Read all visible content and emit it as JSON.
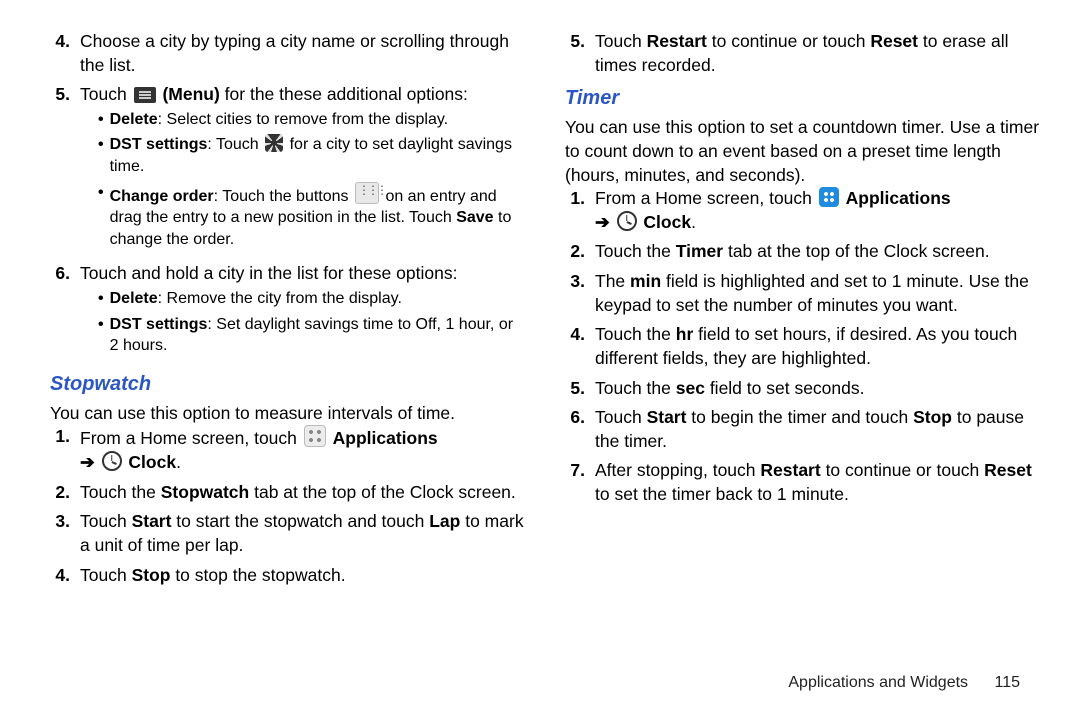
{
  "left": {
    "items": [
      {
        "n": "4.",
        "text": "Choose a city by typing a city name or scrolling through the list."
      },
      {
        "n": "5.",
        "pre": "Touch ",
        "bold1": "(Menu)",
        "post": " for the these additional options:"
      }
    ],
    "bullets5": [
      {
        "bold": "Delete",
        "rest": ": Select cities to remove from the display."
      },
      {
        "bold": "DST settings",
        "pre": ": Touch ",
        "post": " for a city to set daylight savings time."
      },
      {
        "bold": "Change order",
        "pre": ": Touch the buttons ",
        "mid": " on an entry and drag the entry to a new position in the list. Touch ",
        "save": "Save",
        "end": " to change the order."
      }
    ],
    "item6": {
      "n": "6.",
      "text": "Touch and hold a city in the list for these options:"
    },
    "bullets6": [
      {
        "bold": "Delete",
        "rest": ": Remove the city from the display."
      },
      {
        "bold": "DST settings",
        "rest": ": Set daylight savings time to Off, 1 hour, or 2 hours."
      }
    ],
    "stopwatch": {
      "heading": "Stopwatch",
      "intro": "You can use this option to measure intervals of time.",
      "steps": [
        {
          "n": "1.",
          "pre": "From a Home screen, touch ",
          "apps": "Applications",
          "arrow": "➔",
          "clock": "Clock",
          "dot": "."
        },
        {
          "n": "2.",
          "pre": "Touch the ",
          "b1": "Stopwatch",
          "post": " tab at the top of the Clock screen."
        },
        {
          "n": "3.",
          "pre": "Touch ",
          "b1": "Start",
          "mid": " to start the stopwatch and touch ",
          "b2": "Lap",
          "post": " to mark a unit of time per lap."
        },
        {
          "n": "4.",
          "pre": "Touch ",
          "b1": "Stop",
          "post": " to stop the stopwatch."
        }
      ]
    }
  },
  "right": {
    "top5": {
      "n": "5.",
      "pre": "Touch ",
      "b1": "Restart",
      "mid": " to continue or touch ",
      "b2": "Reset",
      "post": " to erase all times recorded."
    },
    "timer": {
      "heading": "Timer",
      "intro": "You can use this option to set a countdown timer. Use a timer to count down to an event based on a preset time length (hours, minutes, and seconds).",
      "steps": [
        {
          "n": "1.",
          "pre": "From a Home screen, touch ",
          "apps": "Applications",
          "arrow": "➔",
          "clock": "Clock",
          "dot": "."
        },
        {
          "n": "2.",
          "pre": "Touch the ",
          "b1": "Timer",
          "post": " tab at the top of the Clock screen."
        },
        {
          "n": "3.",
          "pre": "The ",
          "b1": "min",
          "post": " field is highlighted and set to 1 minute. Use the keypad to set the number of minutes you want."
        },
        {
          "n": "4.",
          "pre": "Touch the ",
          "b1": "hr",
          "post": " field to set hours, if desired. As you touch different fields, they are highlighted."
        },
        {
          "n": "5.",
          "pre": "Touch the ",
          "b1": "sec",
          "post": " field to set seconds."
        },
        {
          "n": "6.",
          "pre": "Touch ",
          "b1": "Start",
          "mid": " to begin the timer and touch ",
          "b2": "Stop",
          "post": " to pause the timer."
        },
        {
          "n": "7.",
          "pre": "After stopping, touch ",
          "b1": "Restart",
          "mid": " to continue or touch ",
          "b2": "Reset",
          "post": " to set the timer back to 1 minute."
        }
      ]
    }
  },
  "footer": {
    "section": "Applications and Widgets",
    "page": "115"
  }
}
